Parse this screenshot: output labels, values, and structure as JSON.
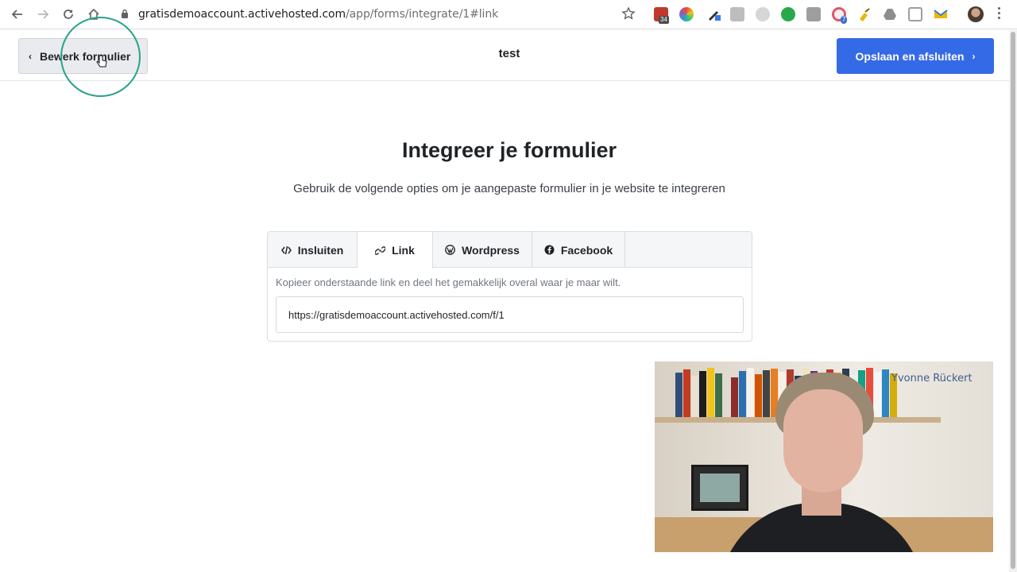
{
  "browser": {
    "url_domain": "gratisdemoaccount.activehosted.com",
    "url_path": "/app/forms/integrate/1#link",
    "ext_badge_count": "34",
    "ext_badge_count_2": "7"
  },
  "header": {
    "back_label": "Bewerk formulier",
    "title": "test",
    "save_label": "Opslaan en afsluiten"
  },
  "main": {
    "heading": "Integreer je formulier",
    "subheading": "Gebruik de volgende opties om je aangepaste formulier in je website te integreren",
    "tabs": [
      {
        "label": "Insluiten",
        "icon": "code-icon"
      },
      {
        "label": "Link",
        "icon": "link-icon"
      },
      {
        "label": "Wordpress",
        "icon": "wordpress-icon"
      },
      {
        "label": "Facebook",
        "icon": "facebook-icon"
      }
    ],
    "active_tab": "Link",
    "description": "Kopieer onderstaande link en deel het gemakkelijk overal waar je maar wilt.",
    "link_value": "https://gratisdemoaccount.activehosted.com/f/1"
  },
  "webcam": {
    "brand_name": "Yvonne Rückert"
  },
  "colors": {
    "primary_button": "#356ae6",
    "click_ring": "#27a389"
  }
}
